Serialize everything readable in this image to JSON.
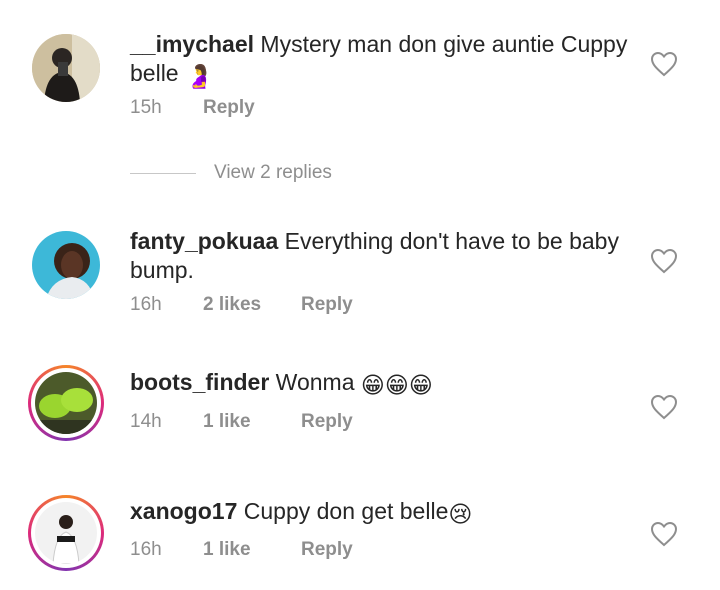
{
  "comments": [
    {
      "username": "__imychael",
      "text": "Mystery man don give auntie Cuppy belle",
      "emoji": "🤰",
      "time": "15h",
      "likes": "",
      "reply": "Reply"
    },
    {
      "username": "fanty_pokuaa",
      "text": "Everything don't have to be baby bump.",
      "emoji": "",
      "time": "16h",
      "likes": "2 likes",
      "reply": "Reply"
    },
    {
      "username": "boots_finder",
      "text": "Wonma",
      "emoji": "😁😁😁",
      "time": "14h",
      "likes": "1 like",
      "reply": "Reply"
    },
    {
      "username": "xanogo17",
      "text": "Cuppy don get belle",
      "emoji": "😢",
      "time": "16h",
      "likes": "1 like",
      "reply": "Reply"
    }
  ],
  "view_replies": "View 2 replies",
  "icons": {
    "like": "heart-icon"
  },
  "colors": {
    "text": "#262626",
    "secondary": "#8e8e8e",
    "story_ring_start": "#f58529",
    "story_ring_end": "#dd2a7b"
  }
}
